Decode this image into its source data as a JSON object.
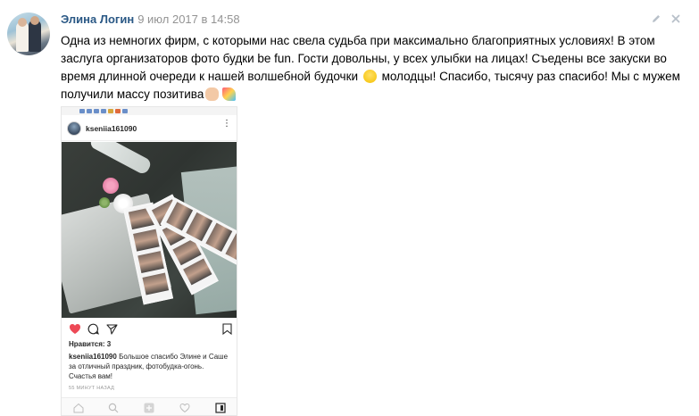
{
  "post": {
    "author": "Элина Логин",
    "date": "9 июл 2017 в 14:58",
    "text_part1": "Одна из немногих фирм, с которыми нас свела судьба при максимально благоприятных условиях! В этом заслуга организаторов фото будки be fun. Гости довольны, у всех улыбки на лицах! Съедены все закуски во время длинной очереди к нашей волшебной будочки",
    "text_part2": "молодцы! Спасибо, тысячу раз спасибо! Мы с мужем получили массу позитива",
    "icons": [
      "edit-icon",
      "close-icon",
      "flushed-emoji",
      "ok-hand-emoji",
      "party-popper-emoji"
    ]
  },
  "attachment": {
    "username": "kseniia161090",
    "likes": "Нравится: 3",
    "caption_user": "kseniia161090",
    "caption_text": "Большое спасибо Элине и Саше за отличный праздник, фотобудка-огонь. Счастья вам!",
    "time": "55 МИНУТ НАЗАД"
  },
  "colors": {
    "author_link": "#2a5885",
    "date": "#939393",
    "like_heart": "#ed4956"
  }
}
